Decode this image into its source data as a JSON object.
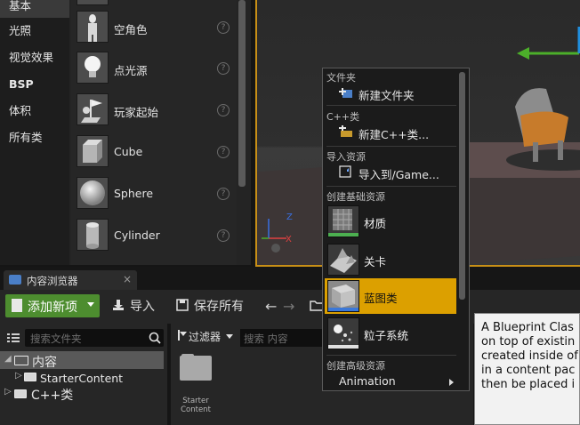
{
  "place_panel": {
    "categories": [
      "基本",
      "光照",
      "视觉效果",
      "BSP",
      "体积",
      "所有类"
    ],
    "actors": [
      {
        "label": "空角色",
        "icon": "empty-character-icon"
      },
      {
        "label": "点光源",
        "icon": "point-light-icon"
      },
      {
        "label": "玩家起始",
        "icon": "player-start-icon"
      },
      {
        "label": "Cube",
        "icon": "cube-icon"
      },
      {
        "label": "Sphere",
        "icon": "sphere-icon"
      },
      {
        "label": "Cylinder",
        "icon": "cylinder-icon"
      }
    ],
    "help_glyph": "?"
  },
  "content_browser": {
    "tab_label": "内容浏览器",
    "tab_close": "×",
    "toolbar": {
      "add_new_label": "添加新项",
      "import_label": "导入",
      "save_all_label": "保存所有"
    },
    "folders": {
      "search_placeholder": "搜索文件夹",
      "tree": [
        {
          "label": "内容",
          "selected": true
        },
        {
          "label": "StarterContent",
          "selected": false
        },
        {
          "label": "C++类",
          "selected": false
        }
      ]
    },
    "assets": {
      "filter_label": "过滤器",
      "search_placeholder": "搜索 内容",
      "items": [
        {
          "label_line1": "Starter",
          "label_line2": "Content"
        }
      ]
    }
  },
  "tooltip": {
    "lines": [
      "A Blueprint Clas",
      "on top of existin",
      "created inside of",
      "in a content pac",
      "then be placed i"
    ]
  },
  "context_menu": {
    "sections": {
      "folder": "文件夹",
      "cpp": "C++类",
      "import": "导入资源",
      "basic": "创建基础资源",
      "advanced": "创建高级资源"
    },
    "items": {
      "new_folder": "新建文件夹",
      "new_cpp": "新建C++类...",
      "import_to": "导入到/Game...",
      "material": "材质",
      "level": "关卡",
      "blueprint": "蓝图类",
      "particle": "粒子系统",
      "animation": "Animation"
    }
  },
  "colors": {
    "accent_orange": "#dca000",
    "add_button_green": "#4d8d2f",
    "viewport_border": "#c88f16"
  }
}
